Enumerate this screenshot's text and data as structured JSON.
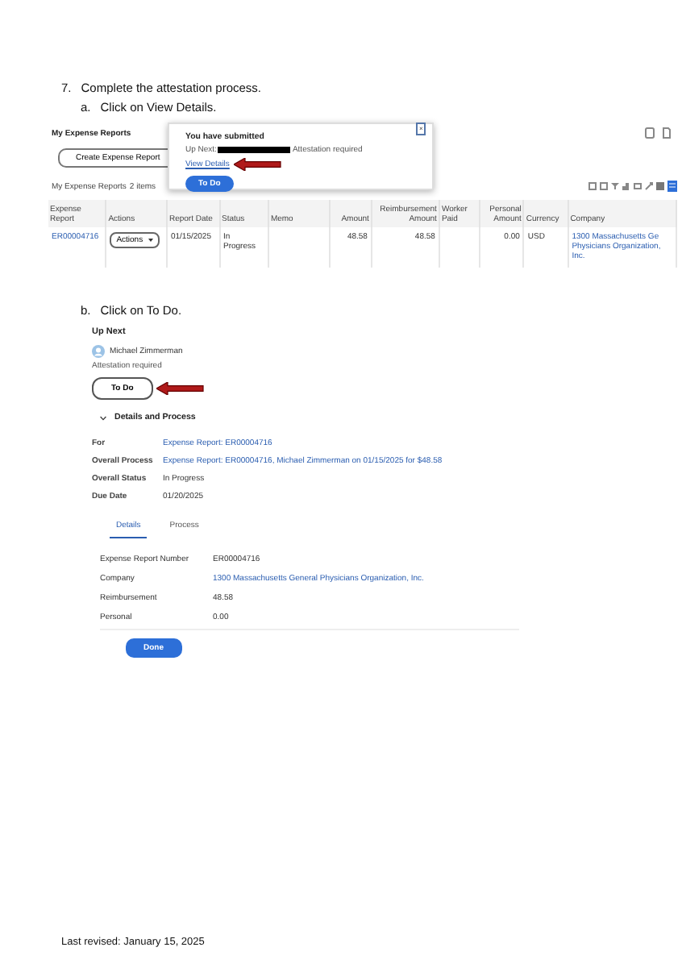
{
  "step": {
    "number": "7.",
    "text": "Complete the attestation process."
  },
  "substeps": [
    {
      "letter": "a.",
      "text": "Click on View Details."
    },
    {
      "letter": "b.",
      "text": "Click on To Do."
    }
  ],
  "expense_reports": {
    "title": "My Expense Reports",
    "create_button": "Create Expense Report",
    "list_title": "My Expense Reports",
    "count": "2 items",
    "columns": [
      "Expense Report",
      "Actions",
      "Report Date",
      "Status",
      "Memo",
      "Amount",
      "Reimbursement Amount",
      "Worker Paid",
      "Personal Amount",
      "Currency",
      "Company"
    ],
    "rows": [
      {
        "cells": [
          {
            "kind": "link",
            "text": "ER00004716"
          },
          {
            "kind": "menu",
            "text": "Actions"
          },
          {
            "kind": "text",
            "text": "01/15/2025"
          },
          {
            "kind": "text",
            "text": "In Progress"
          },
          {
            "kind": "empty"
          },
          {
            "kind": "number",
            "text": "48.58"
          },
          {
            "kind": "number",
            "text": "48.58"
          },
          {
            "kind": "empty"
          },
          {
            "kind": "number",
            "text": "0.00"
          },
          {
            "kind": "text",
            "text": "USD"
          },
          {
            "kind": "link",
            "text": "1300 Massachusetts Ge Physicians Organization, Inc."
          }
        ]
      }
    ]
  },
  "dialog": {
    "title": "You have submitted",
    "up_next_label": "Up Next:",
    "up_next_text": "Attestation required",
    "link": "View Details",
    "button": "To Do",
    "close": "×"
  },
  "up_next": {
    "title": "Up Next",
    "person": "Michael Zimmerman",
    "task": "Attestation required",
    "button": "To Do"
  },
  "details_process": {
    "title": "Details and Process",
    "expanded": true,
    "fields": [
      {
        "label": "For",
        "value": "Expense Report: ER00004716",
        "link": true
      },
      {
        "label": "Overall Process",
        "value": "Expense Report: ER00004716, Michael Zimmerman on 01/15/2025 for $48.58",
        "link": true
      },
      {
        "label": "Overall Status",
        "value": "In Progress",
        "link": false
      },
      {
        "label": "Due Date",
        "value": "01/20/2025",
        "link": false
      }
    ],
    "tabs": [
      {
        "label": "Details",
        "selected": true
      },
      {
        "label": "Process",
        "selected": false
      }
    ],
    "details": [
      {
        "label": "Expense Report Number",
        "value": "ER00004716",
        "link": false
      },
      {
        "label": "Company",
        "value": "1300 Massachusetts General Physicians Organization, Inc.",
        "link": true
      },
      {
        "label": "Reimbursement",
        "value": "48.58",
        "link": false
      },
      {
        "label": "Personal",
        "value": "0.00",
        "link": false
      }
    ],
    "done_button": "Done"
  },
  "footer": "Last revised: January 15, 2025"
}
